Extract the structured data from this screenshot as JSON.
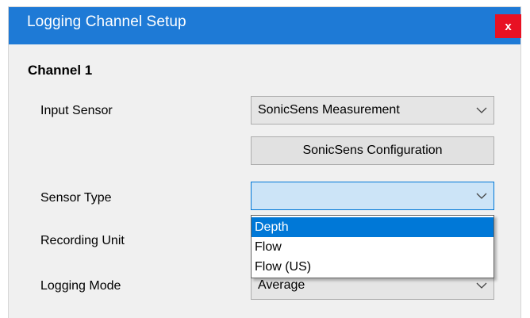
{
  "window": {
    "title": "Logging Channel Setup",
    "close_glyph": "x"
  },
  "section": {
    "heading": "Channel 1"
  },
  "fields": {
    "input_sensor": {
      "label": "Input Sensor",
      "value": "SonicSens Measurement"
    },
    "config_button": {
      "label": "SonicSens Configuration"
    },
    "sensor_type": {
      "label": "Sensor Type",
      "value": "",
      "options": [
        "Depth",
        "Flow",
        "Flow (US)"
      ],
      "highlighted_option": "Depth"
    },
    "recording_unit": {
      "label": "Recording Unit"
    },
    "logging_mode": {
      "label": "Logging Mode",
      "value": "Average"
    }
  },
  "colors": {
    "titlebar": "#1e7ad6",
    "close_button": "#e81123",
    "selection": "#0078d7",
    "open_combo": "#cce4f7"
  },
  "icons": {
    "dropdown_arrow": "chevron-down-icon"
  }
}
